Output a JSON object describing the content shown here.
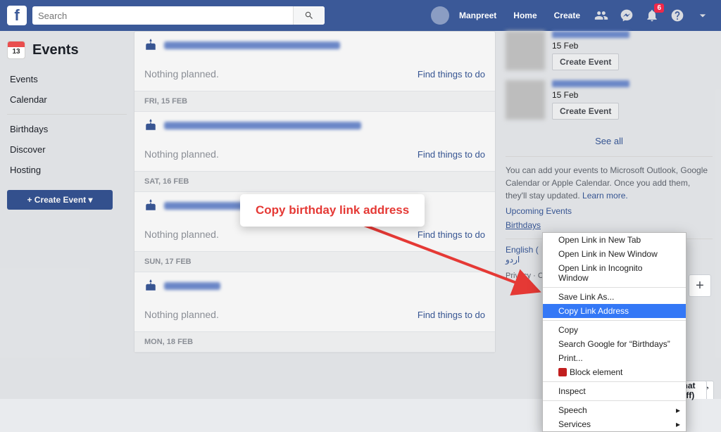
{
  "topbar": {
    "search_placeholder": "Search",
    "user_name": "Manpreet",
    "home": "Home",
    "create": "Create",
    "notif_count": "6"
  },
  "sidebar": {
    "title": "Events",
    "items": [
      "Events",
      "Calendar",
      "Birthdays",
      "Discover",
      "Hosting"
    ],
    "create_label": "+  Create Event ▾"
  },
  "days": [
    {
      "header": "",
      "nothing": "Nothing planned.",
      "find": "Find things to do",
      "blur_w": 250
    },
    {
      "header": "FRI, 15 FEB",
      "nothing": "Nothing planned.",
      "find": "Find things to do",
      "blur_w": 280
    },
    {
      "header": "SAT, 16 FEB",
      "nothing": "Nothing planned.",
      "find": "Find things to do",
      "blur_w": 115
    },
    {
      "header": "SUN, 17 FEB",
      "nothing": "Nothing planned.",
      "find": "Find things to do",
      "blur_w": 80
    },
    {
      "header": "MON, 18 FEB",
      "nothing": "Nothing planned.",
      "find": "Find things to do",
      "blur_w": 0
    }
  ],
  "right": {
    "suggestions": [
      {
        "date": "15 Feb",
        "btn": "Create Event"
      },
      {
        "date": "15 Feb",
        "btn": "Create Event"
      }
    ],
    "see_all": "See all",
    "export_text": "You can add your events to Microsoft Outlook, Google Calendar or Apple Calendar. Once you add them, they'll stay updated. ",
    "learn_more": "Learn more.",
    "upcoming": "Upcoming Events",
    "birthdays_link": "Birthdays",
    "lang": "English (",
    "lang2": "اردو",
    "footer": "Privacy · \nCookies · \nFacebook"
  },
  "callout": "Copy birthday link address",
  "ctx": {
    "items": [
      "Open Link in New Tab",
      "Open Link in New Window",
      "Open Link in Incognito Window"
    ],
    "save": "Save Link As...",
    "copy_addr": "Copy Link Address",
    "copy": "Copy",
    "search": "Search Google for “Birthdays”",
    "print": "Print...",
    "block": "Block element",
    "inspect": "Inspect",
    "speech": "Speech",
    "services": "Services"
  },
  "chat": {
    "label": "Chat (Off)"
  }
}
